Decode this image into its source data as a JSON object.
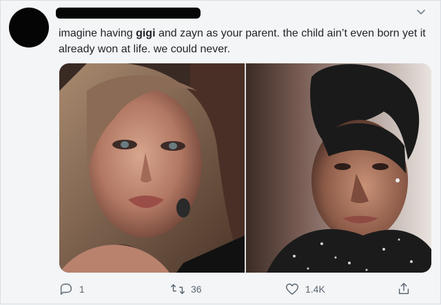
{
  "tweet": {
    "text_parts": {
      "pre": "imagine having ",
      "bold": "gigi",
      "post": " and zayn as your parent. the child ain’t even born yet it already won at life. we could never."
    }
  },
  "actions": {
    "reply_count": "1",
    "retweet_count": "36",
    "like_count": "1.4K"
  },
  "icons": {
    "more": "chevron-down-icon",
    "reply": "reply-icon",
    "retweet": "retweet-icon",
    "like": "heart-icon",
    "share": "share-icon"
  },
  "colors": {
    "text": "#1f2328",
    "muted": "#5b6670",
    "background": "#f3f5f7"
  }
}
